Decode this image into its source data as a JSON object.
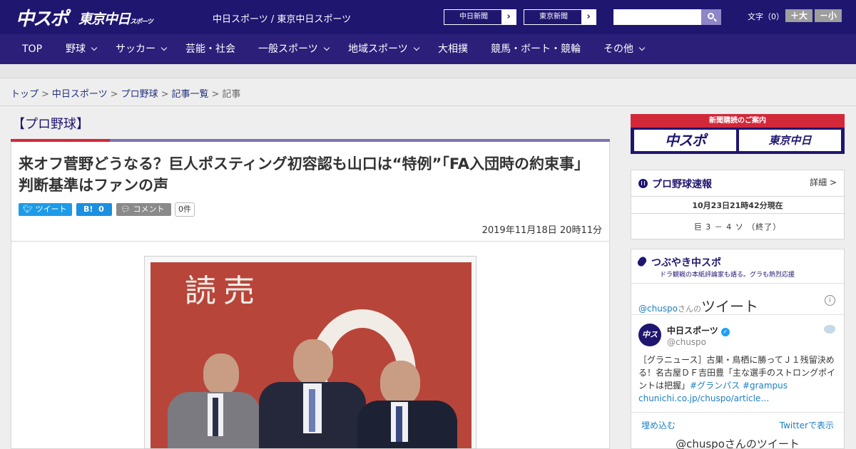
{
  "header": {
    "logo_chunichi": "中スポ",
    "logo_tokyo": "東京中日",
    "logo_tokyo_small": "スポーツ",
    "site_links": "中日スポーツ / 東京中日スポーツ",
    "paper_links": [
      "中日新聞",
      "東京新聞"
    ],
    "search_placeholder": "",
    "font_size_label": "文字（0）",
    "font_larger": "＋大",
    "font_smaller": "－小"
  },
  "nav": [
    {
      "label": "TOP",
      "dropdown": false
    },
    {
      "label": "野球",
      "dropdown": true
    },
    {
      "label": "サッカー",
      "dropdown": true
    },
    {
      "label": "芸能・社会",
      "dropdown": false
    },
    {
      "label": "一般スポーツ",
      "dropdown": true
    },
    {
      "label": "地域スポーツ",
      "dropdown": true
    },
    {
      "label": "大相撲",
      "dropdown": false
    },
    {
      "label": "競馬・ボート・競輪",
      "dropdown": false
    },
    {
      "label": "その他",
      "dropdown": true
    }
  ],
  "breadcrumb": {
    "items": [
      "トップ",
      "中日スポーツ",
      "プロ野球",
      "記事一覧"
    ],
    "current": "記事",
    "separator": ">"
  },
  "article": {
    "category": "【プロ野球】",
    "title": "来オフ菅野どうなる？巨人ポスティング初容認も山口は“特例”「FA入団時の約束事」判断基準はファンの声",
    "tweet_label": "ツイート",
    "hatena_label": "B!",
    "hatena_count": "0",
    "comment_label": "コメント",
    "comment_count": "0件",
    "date": "2019年11月18日 20時11分",
    "photo_text": "読売"
  },
  "sidebar": {
    "subscribe_title": "新聞購読のご案内",
    "subscribe_chunichi": "中スポ",
    "subscribe_tokyo": "東京中日",
    "baseball": {
      "title": "プロ野球速報",
      "detail": "詳細 >",
      "timestamp": "10月23日21時42分現在",
      "score": "巨 3 － 4 ソ （終了）"
    },
    "tsubuyaki": {
      "title": "つぶやき中スポ",
      "subtitle": "ドラ観戦の本紙評論家も語る。グラも熱烈応援",
      "handle": "@chuspo",
      "san": "さんの",
      "tweet_word": "ツイート",
      "info": "i",
      "account_name": "中日スポーツ",
      "account_handle": "@chuspo",
      "avatar_text": "中スポ",
      "tweet_text": "［グラニュース］古巣・鳥栖に勝ってＪ１残留決める！名古屋ＤＦ吉田豊「主な選手のストロングポイントは把握」",
      "hashtags": "#グランパス #grampus",
      "link": "chunichi.co.jp/chuspo/article…",
      "embed": "埋め込む",
      "view_on_twitter": "Twitterで表示",
      "bottom_text": "@chuspoさんのツイート"
    }
  },
  "colors": {
    "header_bg": "#1f1670",
    "nav_bg": "#2b1f7a",
    "accent_red": "#d3283a",
    "accent_purple": "#7f73b8",
    "link": "#1b7fc4"
  }
}
